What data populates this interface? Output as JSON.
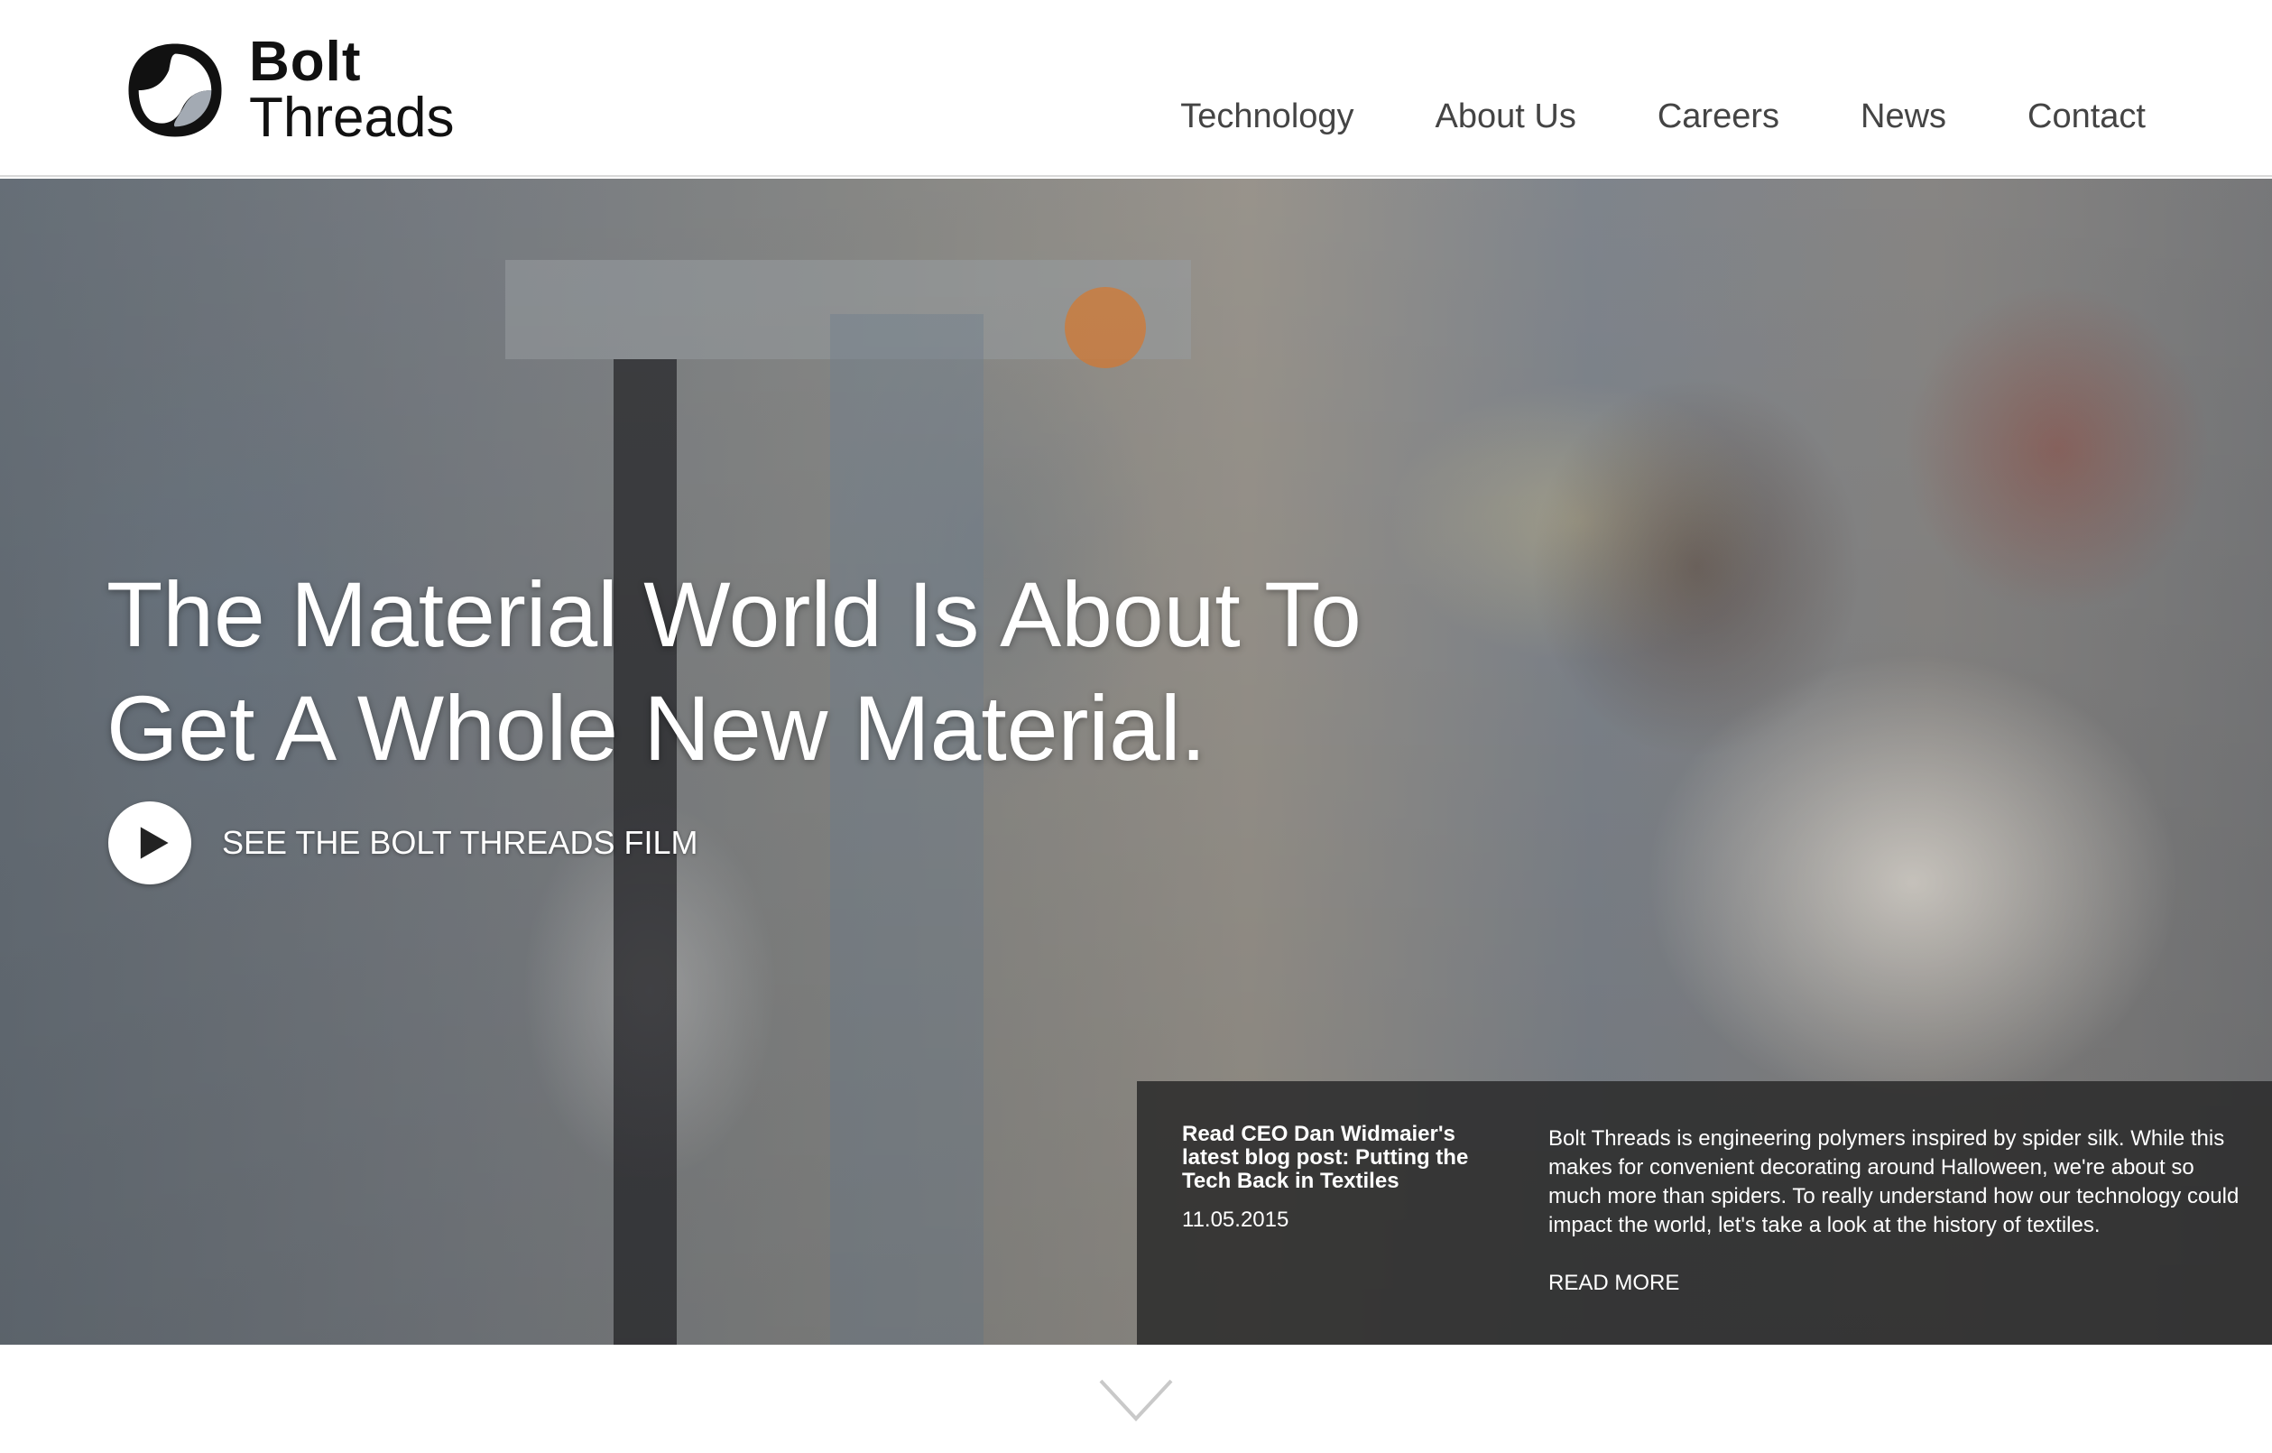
{
  "brand": {
    "name_line1": "Bolt",
    "name_line2": "Threads"
  },
  "nav": {
    "items": [
      {
        "label": "Technology"
      },
      {
        "label": "About Us"
      },
      {
        "label": "Careers"
      },
      {
        "label": "News"
      },
      {
        "label": "Contact"
      }
    ]
  },
  "hero": {
    "headline": "The Material World Is About To Get A Whole New Material.",
    "film_label": "SEE THE BOLT THREADS FILM",
    "play_icon": "play-icon"
  },
  "news": {
    "link_text": "Read CEO Dan Widmaier's latest blog post: Putting the Tech Back in Textiles",
    "date": "11.05.2015",
    "blurb": "Bolt Threads is engineering polymers inspired by spider silk. While this makes for convenient decorating around Halloween, we're about so much more than spiders. To really understand how our technology could impact the world, let's take a look at the history of textiles.",
    "read_more": "READ MORE"
  },
  "scroll": {
    "icon": "chevron-down-icon"
  },
  "colors": {
    "nav_text": "#444444",
    "panel_bg": "#2c2c2c",
    "logo_grey": "#a3aab3"
  }
}
